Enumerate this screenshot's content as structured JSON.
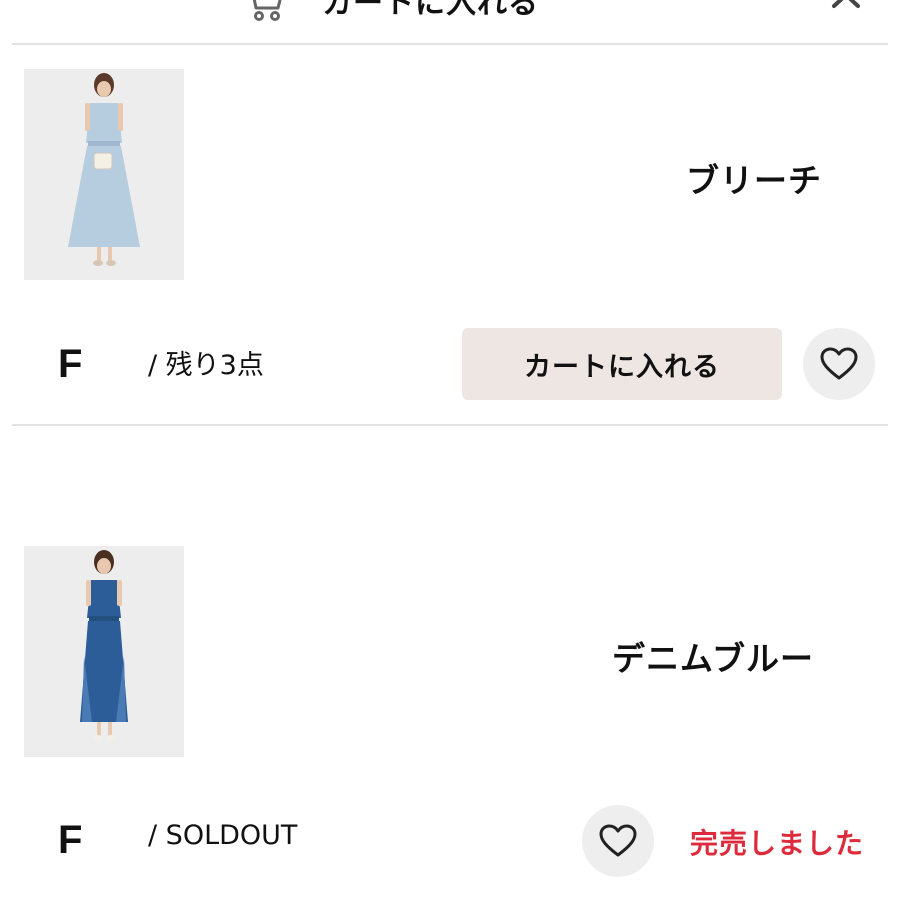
{
  "header": {
    "title": "カートに入れる",
    "cart_icon": "cart-icon",
    "close_icon": "close-icon"
  },
  "items": [
    {
      "color": "ブリーチ",
      "size": "F",
      "stock": "/ 残り3点",
      "cart_label": "カートに入れる",
      "favorite_icon": "heart-outline-icon",
      "dress_color": "#b6cde0"
    },
    {
      "color": "デニムブルー",
      "size": "F",
      "stock": "/ SOLDOUT",
      "status": "完売しました",
      "favorite_icon": "heart-outline-icon",
      "status_color": "#dd2b3b",
      "dress_color": "#2d5d98"
    }
  ]
}
